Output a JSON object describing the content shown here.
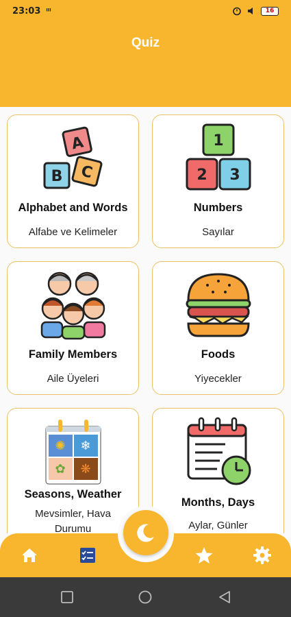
{
  "status_bar": {
    "time": "23:03",
    "signal_text": "ⁱˡˡ",
    "battery": "16"
  },
  "header": {
    "title": "Quiz"
  },
  "categories": [
    {
      "title": "Alphabet and Words",
      "subtitle": "Alfabe ve Kelimeler",
      "icon": "alphabet-blocks-icon"
    },
    {
      "title": "Numbers",
      "subtitle": "Sayılar",
      "icon": "number-blocks-icon"
    },
    {
      "title": "Family Members",
      "subtitle": "Aile Üyeleri",
      "icon": "family-icon"
    },
    {
      "title": "Foods",
      "subtitle": "Yiyecekler",
      "icon": "hamburger-icon"
    },
    {
      "title": "Seasons, Weather",
      "subtitle": "Mevsimler, Hava Durumu",
      "icon": "seasons-calendar-icon"
    },
    {
      "title": "Months, Days",
      "subtitle": "Aylar, Günler",
      "icon": "calendar-clock-icon"
    }
  ],
  "bottom_nav": {
    "items": [
      "home-icon",
      "quiz-icon",
      "theme-moon-icon",
      "star-icon",
      "gear-icon"
    ]
  },
  "colors": {
    "accent": "#f8b62f",
    "card_border": "#e9c267",
    "system_nav": "#3a3a3a"
  }
}
